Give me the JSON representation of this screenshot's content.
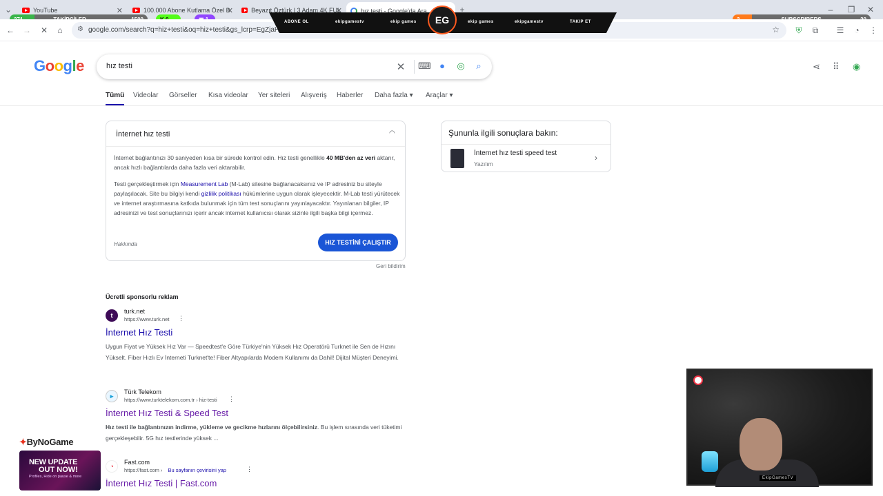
{
  "browser": {
    "tabs": [
      {
        "title": "YouTube",
        "icon": "youtube-icon"
      },
      {
        "title": "100.000 Abone Kutlama Özel B",
        "icon": "youtube-icon"
      },
      {
        "title": "Beyazıt Öztürk | 3 Adam 4K FUL",
        "icon": "youtube-icon"
      },
      {
        "title": "hız testi - Google'da Ara",
        "icon": "google-icon"
      }
    ],
    "url": "google.com/search?q=hiz+testi&oq=hiz+testi&gs_lcrp=EgZjaHJvbWUqEAgAEAAYgwEYsQMYgAQyDQgEEAAYgwEYsQMYgAQyDQgFEAAYgwEYsQMYgAQ..."
  },
  "overlay": {
    "followers_count": "271",
    "followers_label": "TAKİPÇİLER",
    "followers_goal": "1500",
    "kick_count": "0",
    "twitch_count": "1",
    "subs_count": "3",
    "subs_label": "SUBSCRIBERS",
    "subs_goal": "20",
    "banner_items": [
      "ABONE OL",
      "ekipgamestv",
      "ekip games",
      "ekip games",
      "ekipgamestv",
      "TAKIP ET"
    ],
    "logo_text": "EG",
    "webcam_tag": "EkipGamesTV"
  },
  "google": {
    "logo_letters": [
      "G",
      "o",
      "o",
      "g",
      "l",
      "e"
    ],
    "query": "hız testi",
    "nav": [
      {
        "label": "Tümü",
        "active": true
      },
      {
        "label": "Videolar"
      },
      {
        "label": "Görseller"
      },
      {
        "label": "Kısa videolar"
      },
      {
        "label": "Yer siteleri"
      },
      {
        "label": "Alışveriş"
      },
      {
        "label": "Haberler"
      },
      {
        "label": "Daha fazla ▾"
      },
      {
        "label": "Araçlar ▾"
      }
    ],
    "card": {
      "title": "İnternet hız testi",
      "p1_a": "İnternet bağlantınızı 30 saniyeden kısa bir sürede kontrol edin. Hız testi genellikle ",
      "p1_bold": "40 MB'den az veri",
      "p1_b": " aktarır, ancak hızlı bağlantılarda daha fazla veri aktarabilir.",
      "p2_a": "Testi gerçekleştirmek için ",
      "p2_link1": "Measurement Lab",
      "p2_b": " (M-Lab) sitesine bağlanacaksınız ve IP adresiniz bu siteyle paylaşılacak. Site bu bilgiyi kendi ",
      "p2_link2": "gizlilik politikası",
      "p2_c": " hükümlerine uygun olarak işleyecektir. M-Lab testi yürütecek ve internet araştırmasına katkıda bulunmak için tüm test sonuçlarını yayınlayacaktır. Yayınlanan bilgiler, IP adresinizi ve test sonuçlarınızı içerir ancak internet kullanıcısı olarak sizinle ilgili başka bilgi içermez.",
      "about": "Hakkında",
      "run_button": "HIZ TESTİNİ ÇALIŞTIR",
      "feedback": "Geri bildirim"
    },
    "side": {
      "title": "Şununla ilgili sonuçlara bakın:",
      "item_name": "İnternet hız testi speed test",
      "item_sub": "Yazılım"
    },
    "sponsored": "Ücretli sponsorlu reklam",
    "results": [
      {
        "site": "turk.net",
        "url": "https://www.turk.net",
        "title": "İnternet Hız Testi",
        "snippet": "Uygun Fiyat ve Yüksek Hız Var — Speedtest'e Göre Türkiye'nin Yüksek Hız Operatörü Turknet ile Sen de Hızını Yükselt. Fiber Hızlı Ev İnterneti Turknet'te! Fiber Altyapılarda Modem Kullanımı da Dahil! Dijital Müşteri Deneyimi."
      },
      {
        "site": "Türk Telekom",
        "url": "https://www.turktelekom.com.tr › hiz-testi",
        "title": "İnternet Hız Testi & Speed Test",
        "snippet_bold": "Hız testi ile bağlantınızın indirme, yükleme ve gecikme hızlarını ölçebilirsiniz",
        "snippet": ". Bu işlem sırasında veri tüketimi gerçekleşebilir. 5G hız testlerinde yüksek ..."
      },
      {
        "site": "Fast.com",
        "url": "https://fast.com ›",
        "translate": "Bu sayfanın çevirisini yap",
        "title": "İnternet Hız Testi | Fast.com"
      }
    ]
  },
  "stream": {
    "brand": "ByNoGame",
    "promo_line1": "NEW UPDATE",
    "promo_line2": "OUT NOW!",
    "promo_line3": "Profiles, Hide on pause & more"
  }
}
